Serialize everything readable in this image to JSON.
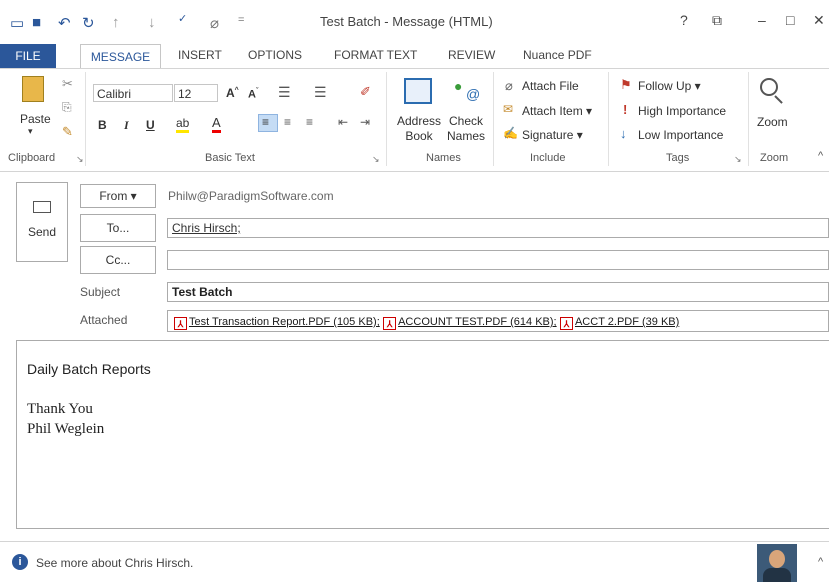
{
  "window": {
    "title": "Test Batch - Message (HTML)",
    "help": "?",
    "restore": "⧉",
    "minimize": "–",
    "maximize": "□",
    "close": "✕"
  },
  "tabs": [
    "FILE",
    "MESSAGE",
    "INSERT",
    "OPTIONS",
    "FORMAT TEXT",
    "REVIEW",
    "Nuance PDF"
  ],
  "ribbon": {
    "clipboard": {
      "paste": "Paste",
      "label": "Clipboard"
    },
    "basic_text": {
      "font": "Calibri",
      "size": "12",
      "bold": "B",
      "italic": "I",
      "underline": "U",
      "label": "Basic Text"
    },
    "names": {
      "address_book": "Address Book",
      "check_names": "Check Names",
      "label": "Names"
    },
    "include": {
      "attach_file": "Attach File",
      "attach_item": "Attach Item ▾",
      "signature": "Signature ▾",
      "label": "Include"
    },
    "tags": {
      "follow_up": "Follow Up ▾",
      "high_importance": "High Importance",
      "low_importance": "Low Importance",
      "label": "Tags"
    },
    "zoom": {
      "zoom": "Zoom",
      "label": "Zoom"
    }
  },
  "header": {
    "send": "Send",
    "from_button": "From ▾",
    "from_value": "Philw@ParadigmSoftware.com",
    "to_button": "To...",
    "to_value": "Chris Hirsch;",
    "cc_button": "Cc...",
    "cc_value": "",
    "subject_label": "Subject",
    "subject_value": "Test Batch",
    "attached_label": "Attached",
    "attachments": [
      "Test Transaction Report.PDF (105 KB);",
      "ACCOUNT TEST.PDF (614 KB);",
      "ACCT 2.PDF (39 KB)"
    ]
  },
  "body": {
    "line1": "Daily Batch Reports",
    "line2": "Thank You",
    "line3": "Phil Weglein"
  },
  "status": {
    "people_text": "See more about Chris Hirsch."
  }
}
